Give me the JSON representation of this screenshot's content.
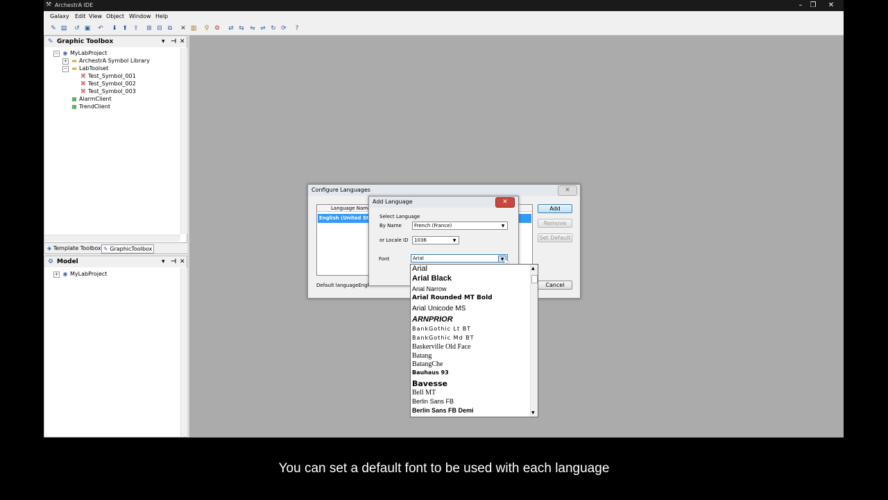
{
  "window": {
    "title": "ArchestrA IDE"
  },
  "menu": [
    "Galaxy",
    "Edit",
    "View",
    "Object",
    "Window",
    "Help"
  ],
  "graphic_toolbox": {
    "title": "Graphic Toolbox",
    "tree": [
      {
        "label": "MyLabProject",
        "icon": "galaxy-icon"
      },
      {
        "label": "ArchestrA Symbol Library",
        "icon": "folder-icon"
      },
      {
        "label": "LabToolset",
        "icon": "folder-icon"
      },
      {
        "label": "Test_Symbol_001",
        "icon": "symbol-icon"
      },
      {
        "label": "Test_Symbol_002",
        "icon": "symbol-icon"
      },
      {
        "label": "Test_Symbol_003",
        "icon": "symbol-icon"
      },
      {
        "label": "AlarmClient",
        "icon": "client-control-icon"
      },
      {
        "label": "TrendClient",
        "icon": "client-control-icon"
      }
    ],
    "tabs": [
      "Template Toolbox",
      "GraphicToolbox"
    ]
  },
  "model": {
    "title": "Model",
    "tree": [
      {
        "label": "MyLabProject",
        "icon": "galaxy-icon"
      }
    ]
  },
  "configure_languages": {
    "title": "Configure Languages",
    "column_header": "Language Name",
    "selected_row": "English (United Sta",
    "buttons": {
      "add": "Add",
      "remove": "Remove",
      "set_default": "Set Default",
      "cancel": "Cancel"
    },
    "default_language": "Default languageEngl"
  },
  "add_language": {
    "title": "Add Language",
    "group_label": "Select Language",
    "by_name_label": "By Name",
    "by_name_value": "French (France)",
    "locale_label": "or Locale ID",
    "locale_value": "1036",
    "font_label": "Font",
    "font_value": "Arial"
  },
  "font_list": [
    "Arial",
    "Arial Black",
    "Arial Narrow",
    "Arial Rounded MT Bold",
    "Arial Unicode MS",
    "ARNPRIOR",
    "BankGothic Lt BT",
    "BankGothic Md BT",
    "Baskerville Old Face",
    "Batang",
    "BatangChe",
    "Bauhaus 93",
    "Bavesse",
    "Bell MT",
    "Berlin Sans FB",
    "Berlin Sans FB Demi"
  ],
  "caption": "You can set a default font to be used with each language",
  "colors": {
    "workspace": "#ababab",
    "selection": "#3399ff",
    "titlebar": "#1a1a1a"
  }
}
